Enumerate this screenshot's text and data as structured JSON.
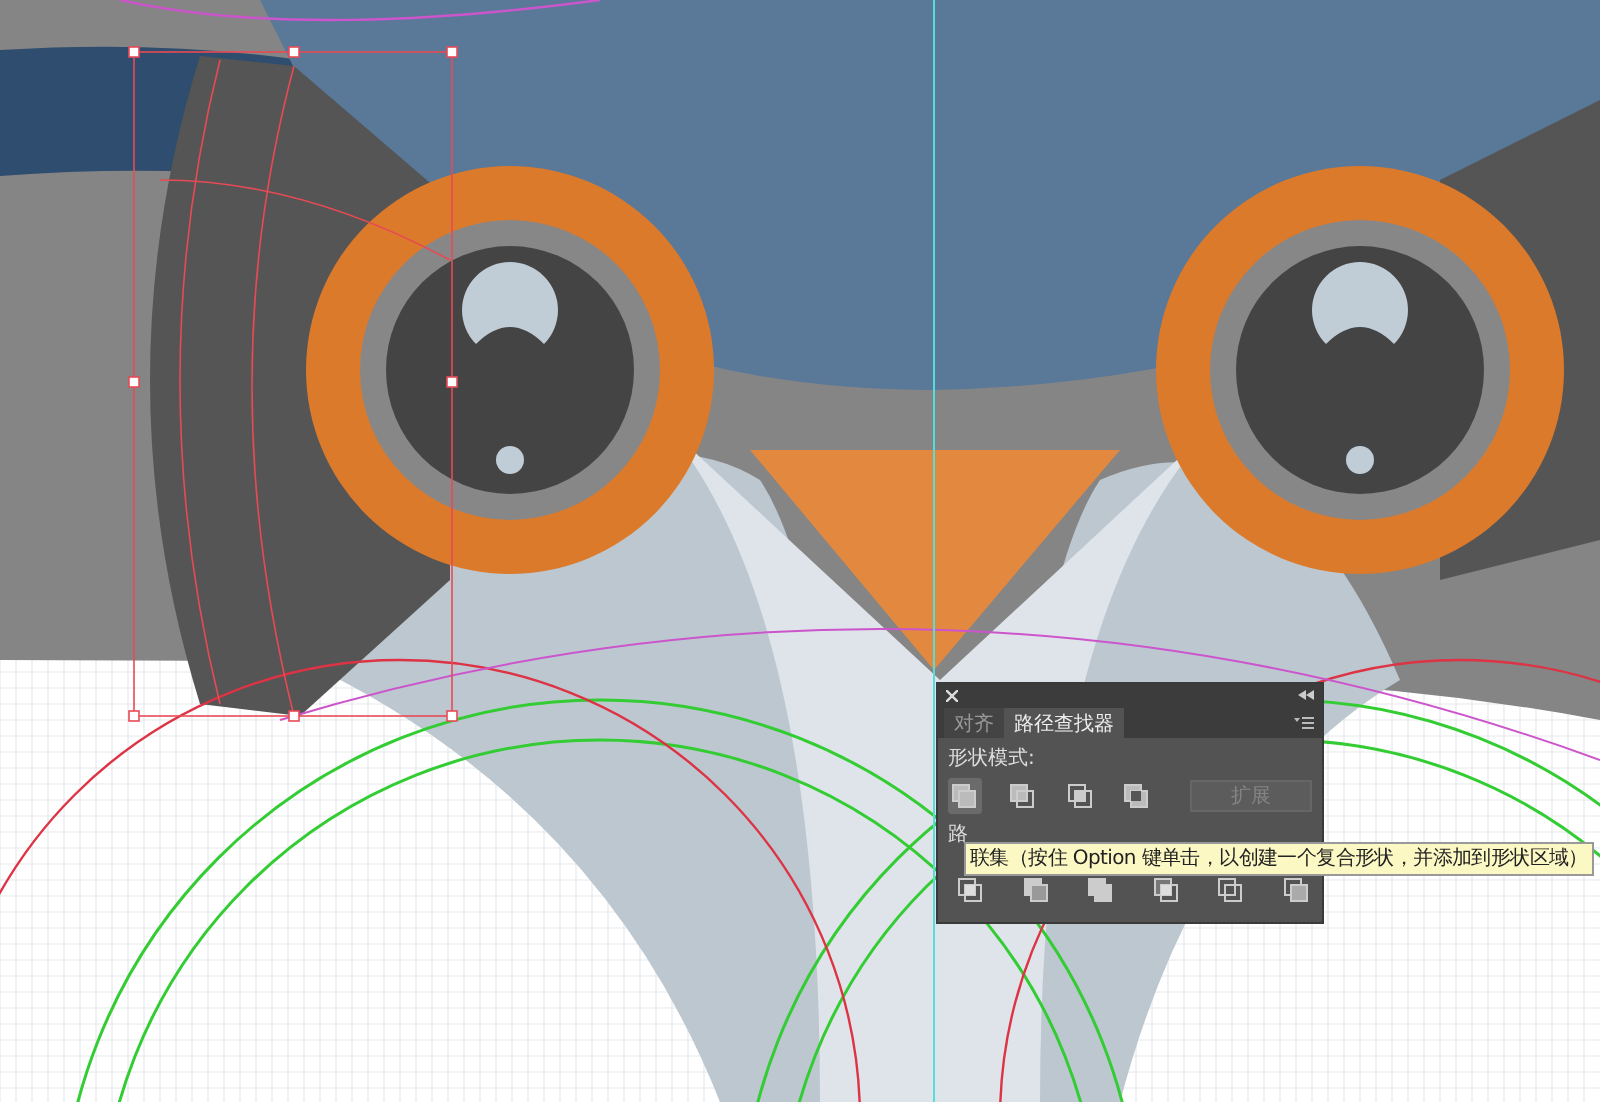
{
  "panel": {
    "tabs": [
      {
        "label": "对齐",
        "selected": false
      },
      {
        "label": "路径查找器",
        "selected": true
      }
    ],
    "shape_modes": {
      "heading": "形状模式:",
      "buttons": [
        {
          "kind": "unite",
          "selected": true
        },
        {
          "kind": "minus_front",
          "selected": false
        },
        {
          "kind": "intersect",
          "selected": false
        },
        {
          "kind": "exclude",
          "selected": false
        }
      ],
      "expand_button": {
        "label": "扩展",
        "disabled": true
      }
    },
    "pathfinders": {
      "heading": "路",
      "buttons": [
        {
          "kind": "divide"
        },
        {
          "kind": "trim"
        },
        {
          "kind": "merge"
        },
        {
          "kind": "crop"
        },
        {
          "kind": "outline"
        },
        {
          "kind": "minus_back"
        }
      ]
    }
  },
  "tooltip": {
    "text": "联集（按住 Option 键单击，以创建一个复合形状，并添加到形状区域）"
  }
}
